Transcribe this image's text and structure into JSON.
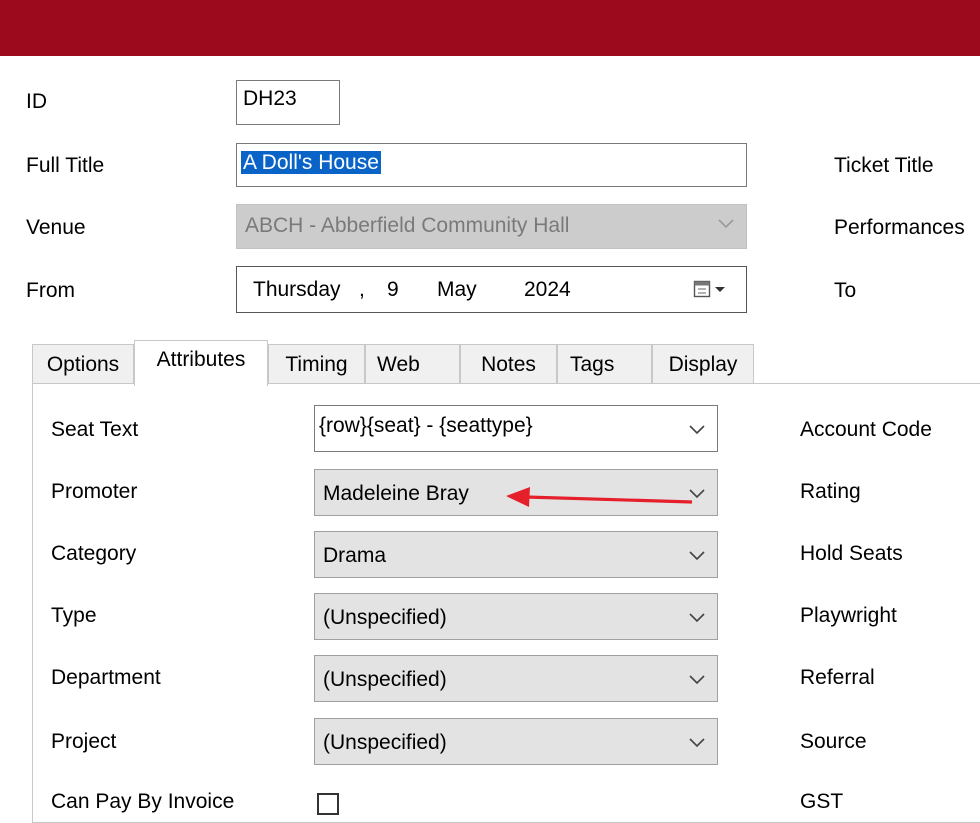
{
  "header": {
    "color": "#9b0a1d"
  },
  "form": {
    "id_label": "ID",
    "id_value": "DH23",
    "full_title_label": "Full Title",
    "full_title_value": "A Doll's House",
    "venue_label": "Venue",
    "venue_value": "ABCH - Abberfield Community Hall",
    "from_label": "From",
    "date": {
      "weekday": "Thursday",
      "sep": ",",
      "day": "9",
      "month": "May",
      "year": "2024"
    },
    "ticket_title_label": "Ticket Title",
    "performances_label": "Performances",
    "to_label": "To"
  },
  "tabs": [
    {
      "label": "Options"
    },
    {
      "label": "Attributes"
    },
    {
      "label": "Timing"
    },
    {
      "label": "Web"
    },
    {
      "label": "Notes"
    },
    {
      "label": "Tags"
    },
    {
      "label": "Display"
    }
  ],
  "active_tab": "Attributes",
  "attributes": {
    "seat_text_label": "Seat Text",
    "seat_text_value": "{row}{seat} - {seattype}",
    "promoter_label": "Promoter",
    "promoter_value": "Madeleine Bray",
    "category_label": "Category",
    "category_value": "Drama",
    "type_label": "Type",
    "type_value": "(Unspecified)",
    "department_label": "Department",
    "department_value": "(Unspecified)",
    "project_label": "Project",
    "project_value": "(Unspecified)",
    "can_pay_label": "Can Pay By Invoice",
    "can_pay_checked": false
  },
  "right_labels": {
    "account_code": "Account Code",
    "rating": "Rating",
    "hold_seats": "Hold Seats",
    "playwright": "Playwright",
    "referral": "Referral",
    "source": "Source",
    "gst": "GST"
  },
  "annotation": {
    "arrow_color": "#e5202b",
    "points_to": "promoter"
  }
}
